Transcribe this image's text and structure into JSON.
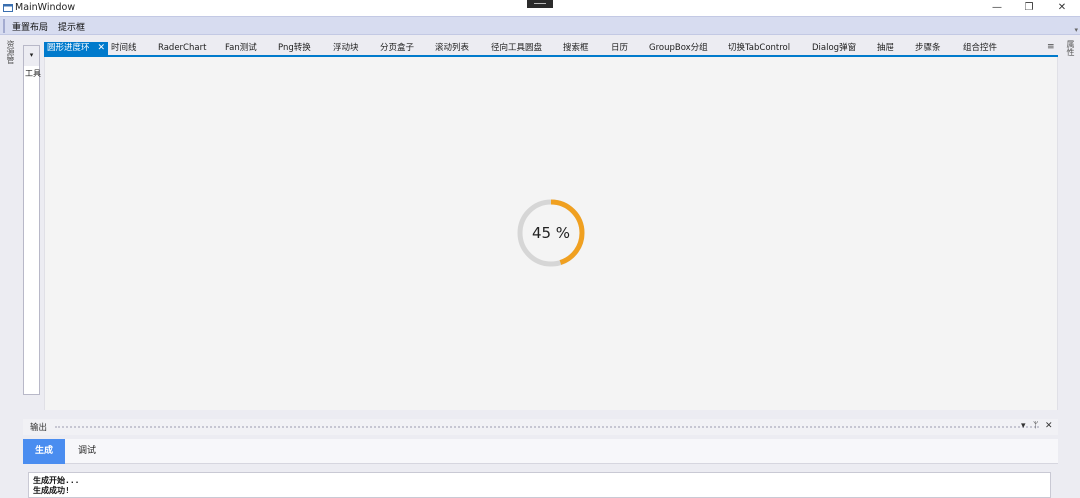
{
  "window": {
    "title": "MainWindow",
    "minimize_glyph": "—",
    "restore_glyph": "❐",
    "close_glyph": "✕"
  },
  "menubar": {
    "items": [
      "重置布局",
      "提示框"
    ]
  },
  "rails": {
    "left_label": "资源管",
    "right_label": "属性"
  },
  "side_panel": {
    "dropdown_glyph": "▾",
    "label": "工具"
  },
  "tabs": {
    "items": [
      "圆形进度环",
      "时间线",
      "RaderChart",
      "Fan测试",
      "Png转换",
      "浮动块",
      "分页盒子",
      "滚动列表",
      "径向工具圆盘",
      "搜索框",
      "日历",
      "GroupBox分组",
      "切换TabControl",
      "Dialog弹窗",
      "抽屉",
      "步骤条",
      "组合控件"
    ],
    "active_index": 0,
    "close_glyph": "✕",
    "menu_glyph": "≡"
  },
  "progress_ring": {
    "value": 45,
    "text": "45 %",
    "track_color": "#d6d6d6",
    "fill_color": "#f0a020"
  },
  "output": {
    "title": "输出",
    "buttons": [
      "▾",
      "ᛘ",
      "✕"
    ],
    "subtabs": [
      "生成",
      "调试"
    ],
    "active_subtab": 0,
    "lines": [
      "生成开始...",
      "生成成功!"
    ]
  },
  "colors": {
    "accent": "#007acc",
    "subtab_active": "#4a8df0",
    "menubar": "#d7dcf0"
  }
}
